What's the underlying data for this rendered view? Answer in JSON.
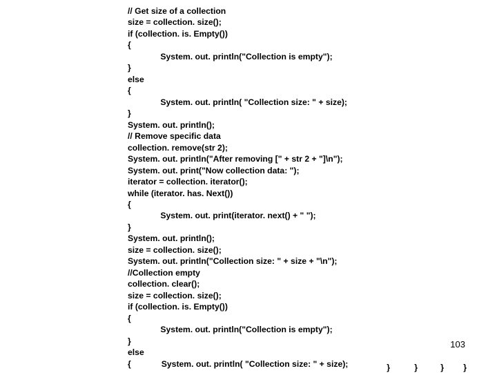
{
  "code": {
    "l1": "// Get size of a collection",
    "l2": "size = collection. size();",
    "l3": "if (collection. is. Empty())",
    "l4": "{",
    "l5": "              System. out. println(\"Collection is empty\");",
    "l6": "}",
    "l7": "else",
    "l8": "{",
    "l9": "              System. out. println( \"Collection size: \" + size);",
    "l10": "}",
    "l11": "System. out. println();",
    "l12": "// Remove specific data",
    "l13": "collection. remove(str 2);",
    "l14": "System. out. println(\"After removing [\" + str 2 + \"]\\n\");",
    "l15": "System. out. print(\"Now collection data: \");",
    "l16": "iterator = collection. iterator();",
    "l17": "while (iterator. has. Next())",
    "l18": "{",
    "l19": "              System. out. print(iterator. next() + \" \");",
    "l20": "}",
    "l21": "System. out. println();",
    "l22": "size = collection. size();",
    "l23": "System. out. println(\"Collection size: \" + size + \"\\n\");",
    "l24": "//Collection empty",
    "l25": "collection. clear();",
    "l26": "size = collection. size();",
    "l27": "if (collection. is. Empty())",
    "l28": "{",
    "l29": "              System. out. println(\"Collection is empty\");",
    "l30": "}",
    "l31": "else",
    "l32": "{             System. out. println( \"Collection size: \" + size);"
  },
  "page_number": "103",
  "brace": "}"
}
